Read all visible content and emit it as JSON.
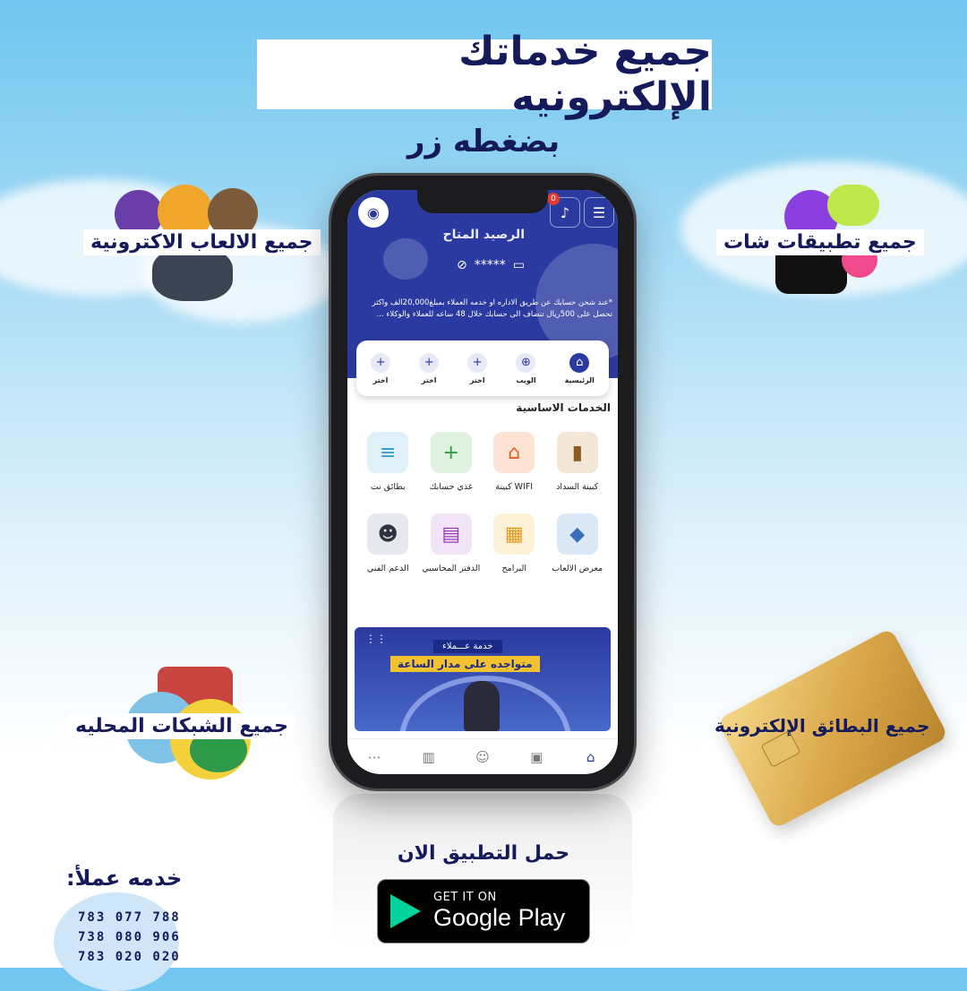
{
  "headline": "جميع خدماتك الإلكترونيه",
  "subheadline": "بضغطه زر",
  "floating_labels": {
    "games": "جميع الالعاب الاكترونية",
    "chat_apps": "جميع تطبيقات شات",
    "networks": "جميع الشبكات المحليه",
    "cards": "جميع البطائق الإلكترونية"
  },
  "app": {
    "notification_count": "0",
    "balance_title": "الرصيد المتاح",
    "balance_masked": "*****",
    "notice": "*عند شحن حسابك عن طريق الاداره او خدمه العملاء بمبلغ20,000الف واكثر تحصل على 500ريال تنضاف الى حسابك خلال 48 ساعه للعملاء والوكلاء ...",
    "quick_actions": [
      {
        "label": "الرئيسية",
        "icon": "home-icon"
      },
      {
        "label": "الويب",
        "icon": "globe-icon"
      },
      {
        "label": "اختر",
        "icon": "plus-icon"
      },
      {
        "label": "اختر",
        "icon": "plus-icon"
      },
      {
        "label": "اختر",
        "icon": "plus-icon"
      }
    ],
    "section_title": "الخدمات الاساسية",
    "services": [
      {
        "label": "كبينة السداد",
        "icon": "payment-cabinet-icon",
        "glyph": "▮",
        "bg": "#f3e6d6",
        "fg": "#8a5a1e"
      },
      {
        "label": "WIFI كبينة",
        "icon": "wifi-cabinet-icon",
        "glyph": "⌂",
        "bg": "#fde3d4",
        "fg": "#e0612a"
      },
      {
        "label": "غذي حسابك",
        "icon": "wallet-icon",
        "glyph": "+",
        "bg": "#dff2df",
        "fg": "#2f9b40"
      },
      {
        "label": "بطائق نت",
        "icon": "net-card-icon",
        "glyph": "≡",
        "bg": "#dff0f8",
        "fg": "#2c9ac9"
      },
      {
        "label": "معرض الالعاب",
        "icon": "games-icon",
        "glyph": "◆",
        "bg": "#dbe8f6",
        "fg": "#3a6fb8"
      },
      {
        "label": "البرامج",
        "icon": "apps-icon",
        "glyph": "▦",
        "bg": "#fdf1d8",
        "fg": "#e39a1a"
      },
      {
        "label": "الدفتر المحاسبي",
        "icon": "ledger-icon",
        "glyph": "▤",
        "bg": "#f1e4f6",
        "fg": "#9a3bb4"
      },
      {
        "label": "الدعم الفني",
        "icon": "support-icon",
        "glyph": "☻",
        "bg": "#e6e8ee",
        "fg": "#2f3340"
      }
    ],
    "promo": {
      "tag": "خدمة عـــملاء",
      "subtitle": "متواجده على مدار الساعة"
    },
    "bottom_nav": [
      {
        "icon": "more-icon",
        "glyph": "⋯"
      },
      {
        "icon": "stats-icon",
        "glyph": "▥"
      },
      {
        "icon": "user-icon",
        "glyph": "☺"
      },
      {
        "icon": "grid-icon",
        "glyph": "▣"
      },
      {
        "icon": "home-icon",
        "glyph": "⌂"
      }
    ]
  },
  "cta": "حمل التطبيق الان",
  "store_badge": {
    "small": "GET IT ON",
    "big": "Google Play"
  },
  "contact": {
    "title": "خدمه عملأ:",
    "phones": [
      "783 077 788",
      "738 080 906",
      "783 020 020"
    ]
  },
  "colors": {
    "navy": "#141a5a",
    "brand_blue": "#2b3aa0"
  }
}
